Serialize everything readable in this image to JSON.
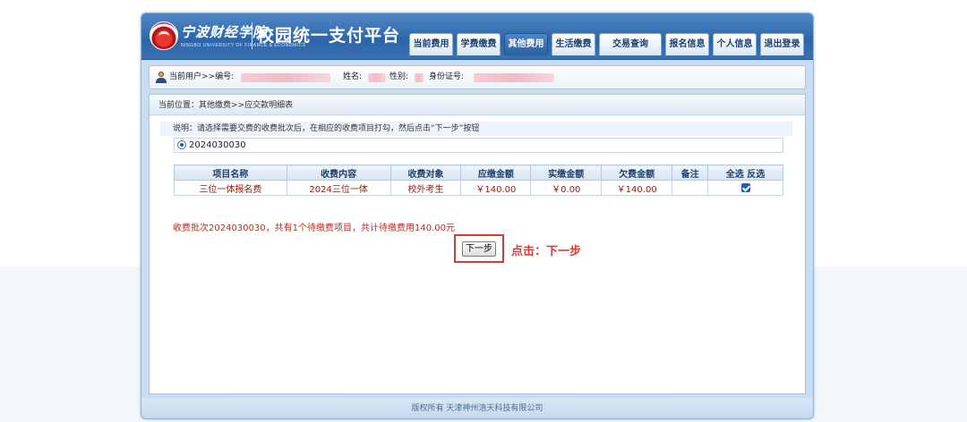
{
  "header": {
    "school_name": "宁波财经学院",
    "school_sub": "NINGBO UNIVERSITY OF FINANCE & ECONOMICS",
    "platform_title": "校园统一支付平台",
    "nav": [
      {
        "label": "当前费用",
        "active": false
      },
      {
        "label": "学费缴费",
        "active": false
      },
      {
        "label": "其他费用",
        "active": true
      },
      {
        "label": "生活缴费",
        "active": false
      },
      {
        "label": "交易查询",
        "active": false
      },
      {
        "label": "报名信息",
        "active": false
      },
      {
        "label": "个人信息",
        "active": false
      },
      {
        "label": "退出登录",
        "active": false
      }
    ]
  },
  "userbar": {
    "prefix": "当前用户>>编号:",
    "name_label": "姓名:",
    "gender_label": "性别:",
    "id_label": "身份证号:"
  },
  "location": "当前位置：其他缴费>>应交款明细表",
  "notice": "说明：请选择需要交费的收费批次后，在相应的收费项目打勾，然后点击“下一步”按钮",
  "batch": {
    "value": "2024030030",
    "selected": true
  },
  "table": {
    "headers": [
      "项目名称",
      "收费内容",
      "收费对象",
      "应缴金额",
      "实缴金额",
      "欠费金额",
      "备注",
      "全选 反选"
    ],
    "rows": [
      {
        "name": "三位一体报名费",
        "content": "2024三位一体",
        "target": "校外考生",
        "due": "￥140.00",
        "paid": "￥0.00",
        "owed": "￥140.00",
        "note": "",
        "checked": true
      }
    ]
  },
  "summary": "收费批次2024030030，共有1个待缴费项目，共计待缴费用140.00元",
  "next_button": "下一步",
  "hint": "点击：下一步",
  "footer": "版权所有 天津神州浩天科技有限公司",
  "colors": {
    "header_blue": "#2e65a8",
    "accent_red": "#d93b32",
    "text_red": "#8a1d14"
  }
}
